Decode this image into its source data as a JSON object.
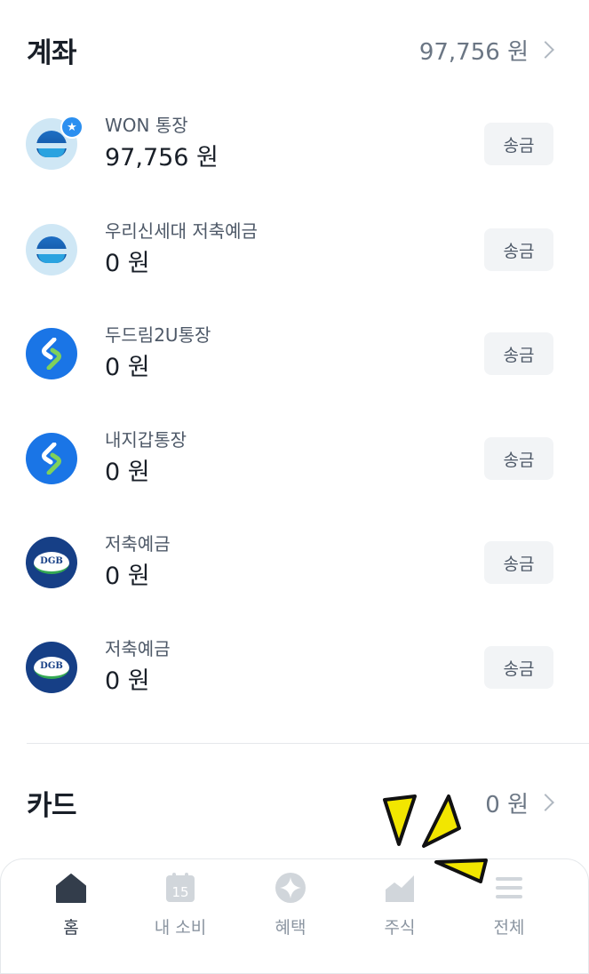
{
  "accounts_section": {
    "title": "계좌",
    "total": "97,756 원"
  },
  "accounts": [
    {
      "name": "WON 통장",
      "balance": "97,756 원",
      "send_label": "송금",
      "icon": "woori-bank-icon",
      "has_star": true
    },
    {
      "name": "우리신세대 저축예금",
      "balance": "0 원",
      "send_label": "송금",
      "icon": "woori-bank-icon"
    },
    {
      "name": "두드림2U통장",
      "balance": "0 원",
      "send_label": "송금",
      "icon": "sc-bank-icon"
    },
    {
      "name": "내지갑통장",
      "balance": "0 원",
      "send_label": "송금",
      "icon": "sc-bank-icon"
    },
    {
      "name": "저축예금",
      "balance": "0 원",
      "send_label": "송금",
      "icon": "dgb-bank-icon"
    },
    {
      "name": "저축예금",
      "balance": "0 원",
      "send_label": "송금",
      "icon": "dgb-bank-icon",
      "logo_text": "DGB"
    }
  ],
  "cards_section": {
    "title": "카드",
    "total": "0 원"
  },
  "tabbar": {
    "tabs": [
      {
        "label": "홈",
        "icon": "home-icon",
        "active": true
      },
      {
        "label": "내 소비",
        "icon": "calendar-icon",
        "badge": "15"
      },
      {
        "label": "혜택",
        "icon": "sparkle-icon"
      },
      {
        "label": "주식",
        "icon": "stock-chart-icon"
      },
      {
        "label": "전체",
        "icon": "menu-icon"
      }
    ]
  },
  "colors": {
    "accent_blue": "#1a75e6",
    "dgb_navy": "#163f86",
    "sparkle_yellow": "#f2e600"
  }
}
